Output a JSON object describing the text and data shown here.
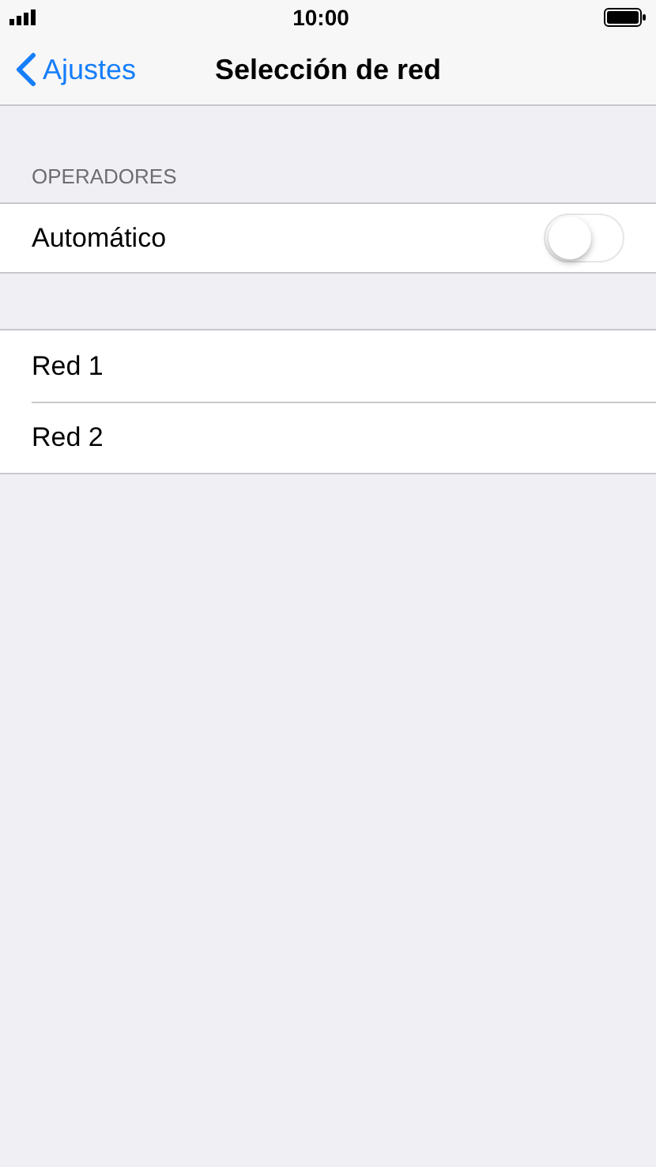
{
  "status_bar": {
    "time": "10:00"
  },
  "nav": {
    "back": "Ajustes",
    "title": "Selección de red"
  },
  "operators": {
    "header": "OPERADORES",
    "automatic": {
      "label": "Automático",
      "on": false
    }
  },
  "networks": [
    {
      "label": "Red 1"
    },
    {
      "label": "Red 2"
    }
  ]
}
